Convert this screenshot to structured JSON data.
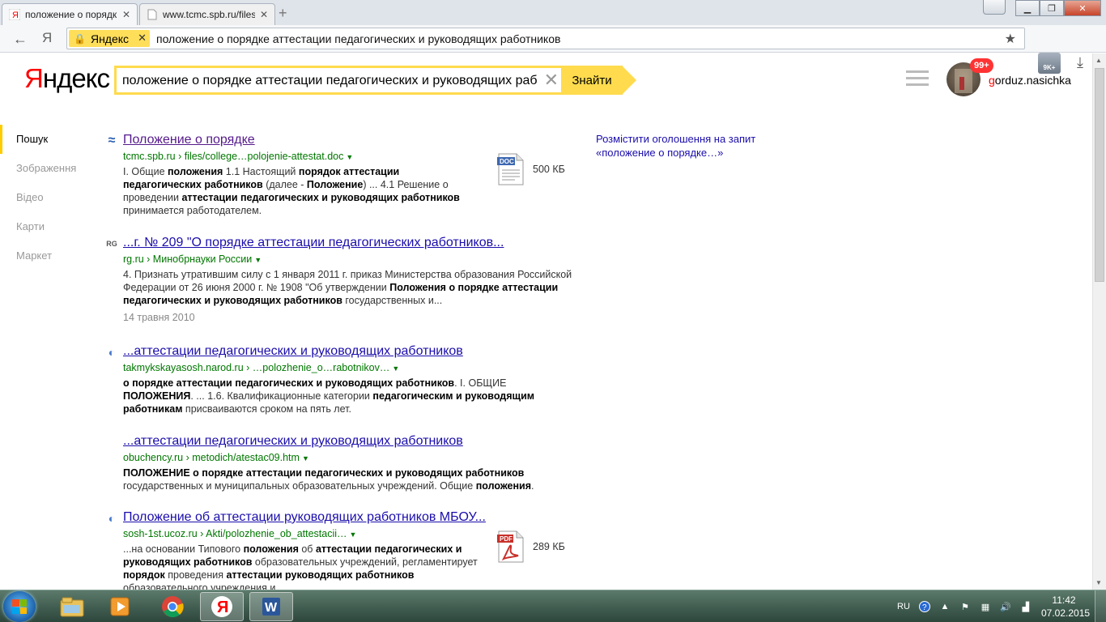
{
  "browser": {
    "tabs": [
      {
        "title": "положение о порядк",
        "active": true
      },
      {
        "title": "www.tcmc.spb.ru/files",
        "active": false
      }
    ],
    "back_glyph": "←",
    "ya_glyph": "Я",
    "address_chip": "Яндекс",
    "address_text": "положение о порядке аттестации педагогических и руководящих работников",
    "extension_badge": "9K+"
  },
  "search": {
    "logo_ya": "Я",
    "logo_rest": "ндекс",
    "query": "положение о порядке аттестации педагогических и руководящих работников",
    "find_label": "Знайти"
  },
  "user": {
    "badge": "99+",
    "name_first": "g",
    "name_rest": "orduz.nasichka"
  },
  "sidenav": {
    "items": [
      {
        "label": "Пошук",
        "active": true
      },
      {
        "label": "Зображення",
        "active": false
      },
      {
        "label": "Відео",
        "active": false
      },
      {
        "label": "Карти",
        "active": false
      },
      {
        "label": "Маркет",
        "active": false
      }
    ]
  },
  "results": [
    {
      "icon": "≈",
      "title": "Положение о порядке",
      "url": "tcmc.spb.ru › files/college…polojenie-attestat.doc",
      "snippet_html": "I. Общие <b>положения</b> 1.1 Настоящий <b>порядок аттестации педагогических работников</b> (далее - <b>Положение</b>) ... 4.1 Решение о проведении <b>аттестации педагогических и руководящих работников</b> принимается работодателем.",
      "file_type": "DOC",
      "file_size": "500 КБ"
    },
    {
      "icon": "RG",
      "title": "...г. № 209 \"О порядке аттестации педагогических работников...",
      "url": "rg.ru › Минобрнауки России",
      "snippet_html": "4. Признать утратившим силу с 1 января 2011 г. приказ Министерства образования Российской Федерации от 26 июня 2000 г. № 1908 \"Об утверждении <b>Положения о порядке аттестации педагогических и руководящих работников</b> государственных и...",
      "date": "14 травня 2010"
    },
    {
      "icon": "◐",
      "title": "...аттестации педагогических и руководящих работников",
      "url": "takmykskayasosh.narod.ru › …polozhenie_o…rabotnikov…",
      "snippet_html": "<b>о порядке аттестации педагогических и руководящих работников</b>. I. ОБЩИЕ <b>ПОЛОЖЕНИЯ</b>. ... 1.6. Квалификационные категории <b>педагогическим и руководящим работникам</b> присваиваются сроком на пять лет."
    },
    {
      "icon": "",
      "title": "...аттестации педагогических и руководящих работников",
      "url": "obuchency.ru › metodich/atestac09.htm",
      "snippet_html": "<b>ПОЛОЖЕНИЕ о порядке аттестации педагогических и руководящих работников</b> государственных и муниципальных образовательных учреждений. Общие <b>положения</b>."
    },
    {
      "icon": "◐",
      "title": "Положение об аттестации руководящих работников МБОУ...",
      "url": "sosh-1st.ucoz.ru › Akti/polozhenie_ob_attestacii…",
      "snippet_html": "...на основании Типового <b>положения</b> об <b>аттестации педагогических и руководящих работников</b> образовательных учреждений, регламентирует <b>порядок</b> проведения <b>аттестации руководящих работников</b> образовательного учреждения и...",
      "file_type": "PDF",
      "file_size": "289 КБ"
    }
  ],
  "ad": {
    "line1": "Розмістити оголошення на запит",
    "line2": "«положение о порядке…»"
  },
  "taskbar": {
    "lang": "RU",
    "time": "11:42",
    "date": "07.02.2015"
  }
}
